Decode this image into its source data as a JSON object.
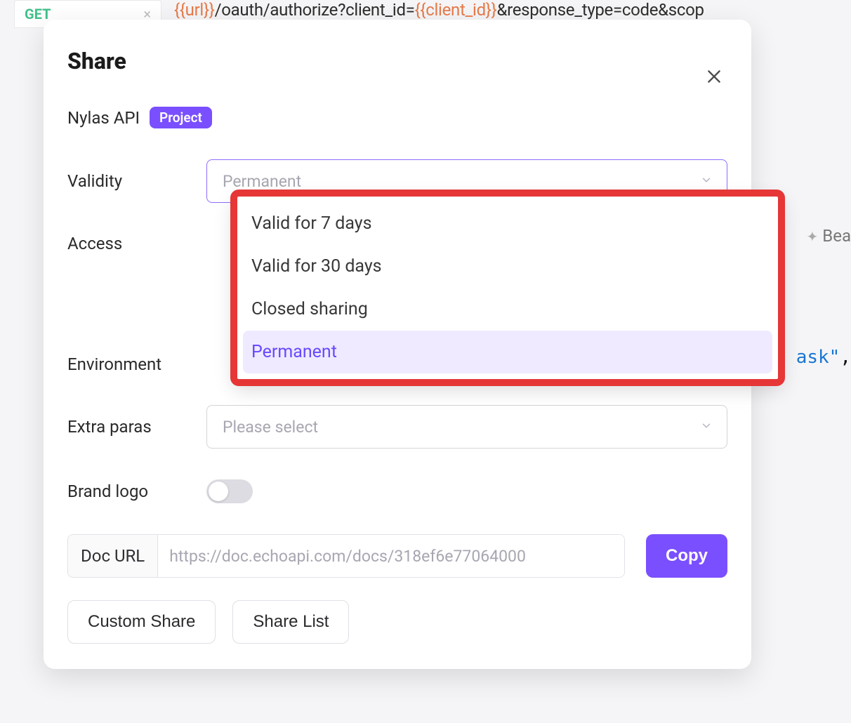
{
  "background": {
    "tab_method": "GET",
    "url_parts": {
      "p1": "{{url}}",
      "p2": "/oauth/authorize?client_id=",
      "p3": "{{client_id}}",
      "p4": "&response_type=code&scop"
    },
    "side_label": "Bea",
    "json_frag": {
      "text": "ask\"",
      "punct": ","
    }
  },
  "modal": {
    "title": "Share",
    "api_name": "Nylas API",
    "badge": "Project",
    "labels": {
      "validity": "Validity",
      "access": "Access",
      "environment": "Environment",
      "extra_paras": "Extra paras",
      "brand_logo": "Brand logo"
    },
    "validity_select": {
      "placeholder": "Permanent",
      "options": [
        "Valid for 7 days",
        "Valid for 30 days",
        "Closed sharing",
        "Permanent"
      ],
      "selected_index": 3
    },
    "extra_paras_select": {
      "placeholder": "Please select"
    },
    "brand_logo_enabled": false,
    "doc_url": {
      "label": "Doc URL",
      "value": "https://doc.echoapi.com/docs/318ef6e77064000"
    },
    "buttons": {
      "copy": "Copy",
      "custom_share": "Custom Share",
      "share_list": "Share List"
    }
  }
}
